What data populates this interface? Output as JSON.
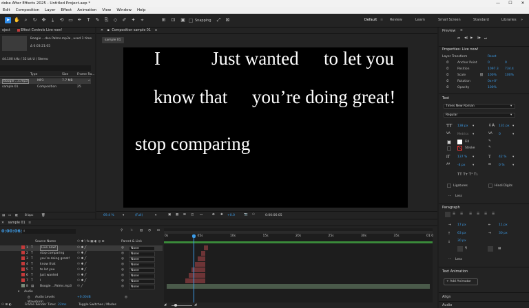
{
  "window": {
    "title": "dobe After Effects 2025 - Untitled Project.aep *",
    "controls": [
      "—",
      "☐",
      "✕"
    ]
  },
  "menu": [
    "Edit",
    "Composition",
    "Layer",
    "Effect",
    "Animation",
    "View",
    "Window",
    "Help"
  ],
  "toolbar": {
    "snapping": "Snapping",
    "workspaces": [
      "Default",
      "Review",
      "Learn",
      "Small Screen",
      "Standard",
      "Libraries"
    ],
    "active_workspace": "Default"
  },
  "project": {
    "tab_label": "oject",
    "effect_controls_label": "Effect Controls Live now!",
    "file_name": "Boogie ...den Palms.mp3▾ , used 1 time",
    "duration": "Δ 0:03:21:05",
    "audio_info": "44.100 kHz / 32 bit U / Stereo",
    "columns": [
      "Type",
      "Size",
      "Frame Ra..."
    ],
    "items": [
      {
        "name": "Boogie ...s.mp3",
        "type": "MP3",
        "size": "7.7 MB",
        "fps": ""
      },
      {
        "name": "sample 01",
        "type": "Composition",
        "size": "",
        "fps": "25"
      }
    ],
    "bpc": "8 bpc"
  },
  "composition": {
    "tab_label": "Composition sample 01",
    "chip": "sample 01",
    "lines": [
      {
        "text": "I",
        "name": "text-I"
      },
      {
        "text": "Just wanted",
        "name": "text-just-wanted"
      },
      {
        "text": "to let you",
        "name": "text-to-let-you"
      },
      {
        "text": "know that",
        "name": "text-know-that"
      },
      {
        "text": "you’re doing great!",
        "name": "text-youre-doing-great"
      },
      {
        "text": "stop comparing",
        "name": "text-stop-comparing"
      }
    ],
    "zoom": "69.4 %",
    "resolution": "(Full)",
    "exposure": "+0.0",
    "timecode": "0:00:06:05"
  },
  "right": {
    "preview_title": "Preview",
    "properties_title": "Properties: Live now!",
    "layer_transform": "Layer Transform",
    "reset": "Reset",
    "transform": [
      {
        "label": "Anchor Point",
        "v1": "0",
        "v2": "0"
      },
      {
        "label": "Position",
        "v1": "1097.3",
        "v2": "734.4"
      },
      {
        "label": "Scale",
        "v1": "100%",
        "v2": "100%"
      },
      {
        "label": "Rotation",
        "v1": "0x+0°",
        "v2": ""
      },
      {
        "label": "Opacity",
        "v1": "100%",
        "v2": ""
      }
    ],
    "text_title": "Text",
    "font": "Times New Roman",
    "style": "Regular",
    "font_size": "138 px",
    "leading": "131 px",
    "kerning": "Metrics",
    "tracking": "0",
    "fill": "Fill",
    "stroke": "Stroke",
    "vscale": "137 %",
    "hscale": "42 %",
    "baseline": "-4 px",
    "tsume": "0 %",
    "ligatures": "Ligatures",
    "hindi_digits": "Hindi Digits",
    "less": "Less",
    "paragraph_title": "Paragraph",
    "indent1": "17 px",
    "indent2": "11 px",
    "space1": "63 px",
    "space2": "30 px",
    "space3": "30 px",
    "text_animation_title": "Text Animation",
    "add_animator": "Add Animator",
    "align_title": "Align",
    "audio_title": "Audio"
  },
  "timeline": {
    "tab": "sample 01",
    "timecode": "0:00:06:05",
    "search_placeholder": "",
    "headers": {
      "source_name": "Source Name",
      "parent": "Parent & Link"
    },
    "ruler": [
      "0s",
      "05s",
      "10s",
      "15s",
      "20s",
      "25s",
      "30s",
      "35s",
      "01:0"
    ],
    "layers": [
      {
        "num": "1",
        "name": "Live now!",
        "parent": "None",
        "start": 0.286
      },
      {
        "num": "2",
        "name": "stop comparing",
        "parent": "None",
        "start": 0.262
      },
      {
        "num": "3",
        "name": "you’re doing great!",
        "parent": "None",
        "start": 0.238
      },
      {
        "num": "4",
        "name": "know that",
        "parent": "None",
        "start": 0.214
      },
      {
        "num": "5",
        "name": "to let you",
        "parent": "None",
        "start": 0.19
      },
      {
        "num": "6",
        "name": "Just wanted",
        "parent": "None",
        "start": 0.167
      },
      {
        "num": "7",
        "name": "I",
        "parent": "None",
        "start": 0.143
      },
      {
        "num": "8",
        "name": "Boogie ...Palms.mp3",
        "parent": "None",
        "start": 0
      }
    ],
    "audio_label": "Audio",
    "audio_levels": "Audio Levels",
    "audio_value": "+0.00dB",
    "wave_label": "Waveform",
    "frame_render": "Frame Render Time:",
    "frame_render_value": "22ms",
    "toggle": "Toggle Switches / Modes"
  },
  "colors": {
    "accent": "#2d8ceb",
    "blue_value": "#3c9ce8",
    "layer_label": "#c43a3a",
    "bar": "#6d3436",
    "green_bar": "#3a8a3a"
  }
}
